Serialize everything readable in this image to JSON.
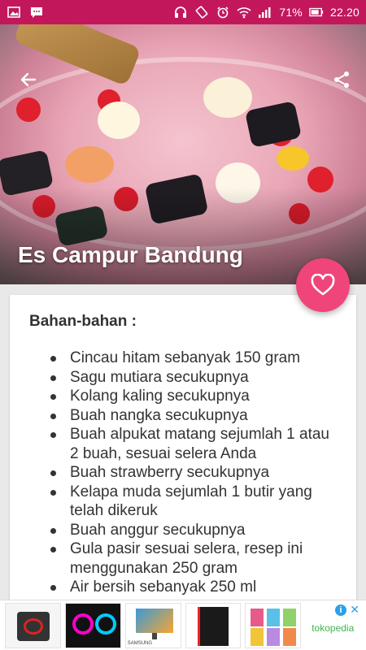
{
  "status_bar": {
    "battery": "71%",
    "time": "22.20"
  },
  "recipe": {
    "title": "Es Campur Bandung",
    "subtitle": "-"
  },
  "ingredients": {
    "heading": "Bahan-bahan :",
    "items": [
      "Cincau hitam sebanyak 150 gram",
      "Sagu mutiara secukupnya",
      "Kolang kaling secukupnya",
      "Buah nangka secukupnya",
      "Buah alpukat matang sejumlah 1 atau 2 buah, sesuai selera Anda",
      "Buah strawberry secukupnya",
      "Kelapa muda sejumlah 1 butir yang telah dikeruk",
      "Buah anggur secukupnya",
      "Gula pasir sesuai selera, resep ini menggunakan 250 gram",
      "Air bersih sebanyak 250 ml"
    ]
  },
  "ad": {
    "brand": "tokopedia",
    "info_icon": "i",
    "close_icon": "✕",
    "thumbnail_caption": "SAMSUNG"
  },
  "colors": {
    "status_bar": "#c2185b",
    "fab": "#f0457a"
  },
  "icons": {
    "back": "back-arrow-icon",
    "share": "share-icon",
    "favorite": "heart-outline-icon"
  }
}
